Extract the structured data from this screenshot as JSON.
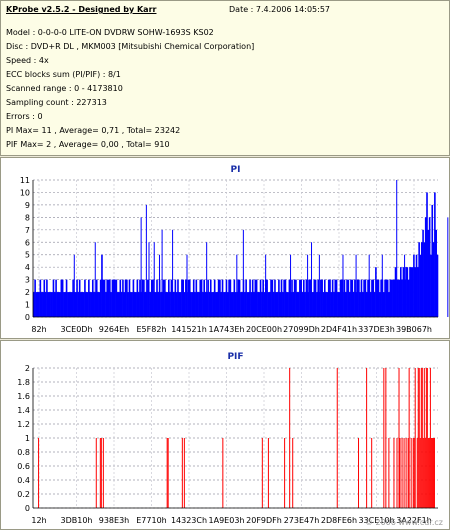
{
  "info": {
    "title": "KProbe v2.5.2 - Designed by Karr",
    "date": "Date : 7.4.2006 14:05:57",
    "lines": [
      "Model : 0-0-0-0 LITE-ON DVDRW SOHW-1693S KS02",
      "Disc : DVD+R DL , MKM003 [Mitsubishi Chemical Corporation]",
      "Speed : 4x",
      "ECC blocks sum (PI/PIF) : 8/1",
      "Scanned range : 0 - 4173810",
      "Sampling count : 227313",
      "Errors : 0",
      "PI Max= 11 , Average= 0,71 , Total= 23242",
      "PIF Max= 2 , Average= 0,00 , Total= 910"
    ]
  },
  "watermark": "© 2006 www.cdr.cz",
  "colors": {
    "pi": "#0000ff",
    "pif": "#ff0000",
    "title": "#1a2fa8"
  },
  "chart_data": [
    {
      "type": "bar",
      "title": "PI",
      "ylim": [
        0,
        11
      ],
      "y_ticks": [
        "0",
        "1",
        "2",
        "3",
        "4",
        "5",
        "6",
        "7",
        "8",
        "9",
        "10",
        "11"
      ],
      "x_ticks": [
        "82h",
        "3CE0Dh",
        "9264Eh",
        "E5F82h",
        "141521h",
        "1A743Eh",
        "20CE00h",
        "27099Dh",
        "2D4F41h",
        "337DE3h",
        "39B067h"
      ],
      "grid": true,
      "series": [
        {
          "values": [
            2,
            3,
            2,
            2,
            2,
            3,
            2,
            2,
            3,
            2,
            3,
            2,
            2,
            2,
            2,
            3,
            2,
            3,
            2,
            2,
            2,
            3,
            3,
            2,
            2,
            3,
            2,
            2,
            2,
            2,
            3,
            2,
            2,
            3,
            2,
            3,
            2,
            2,
            2,
            3,
            2,
            2,
            3,
            2,
            2,
            3,
            2,
            2,
            3,
            2,
            2,
            3,
            5,
            3,
            3,
            2,
            3,
            3,
            3,
            2,
            3,
            3,
            3,
            3,
            2,
            2,
            3,
            2,
            3,
            2,
            3,
            3,
            2,
            3,
            2,
            2,
            3,
            2,
            2,
            3,
            2,
            3,
            2,
            3,
            3,
            2,
            2,
            3,
            2,
            2,
            3,
            3,
            2,
            2,
            3,
            2,
            3,
            2,
            2,
            3,
            3,
            2,
            2,
            3,
            2,
            3,
            2,
            2,
            3,
            2,
            3,
            2,
            2,
            3,
            3,
            2,
            3,
            2,
            3,
            3,
            2,
            2,
            3,
            2,
            3,
            2,
            2,
            3,
            3,
            2,
            3,
            2,
            2,
            3,
            2,
            3,
            2,
            2,
            3,
            2,
            2,
            3,
            3,
            2,
            3,
            2,
            2,
            3,
            2,
            3,
            3,
            2,
            2,
            3,
            2,
            2,
            3,
            3,
            2,
            2,
            3,
            2,
            3,
            2,
            2,
            3,
            2,
            3,
            2,
            3,
            3,
            2,
            2,
            3,
            2,
            3,
            2,
            3,
            3,
            2,
            2,
            3,
            3,
            2,
            3,
            2,
            2,
            3,
            2,
            3,
            2,
            3,
            3,
            2,
            2,
            3,
            2,
            3,
            2,
            3,
            3,
            2,
            2,
            3,
            3,
            2,
            3,
            2,
            3,
            2,
            3,
            3,
            2,
            2,
            3,
            3,
            2,
            3,
            2,
            3,
            3,
            2,
            3,
            2,
            2,
            3,
            3,
            2,
            3,
            2,
            3,
            3,
            2,
            2,
            3,
            3,
            2,
            3,
            2,
            3,
            3,
            2,
            3,
            3,
            2,
            3,
            2,
            3,
            3,
            2,
            3,
            2,
            3,
            3,
            2,
            3,
            3,
            2,
            3,
            3,
            2,
            4,
            3,
            3,
            2,
            3,
            3,
            2,
            3,
            3,
            3,
            2,
            3,
            3,
            3,
            3,
            4,
            3,
            3,
            3,
            4,
            3,
            4,
            3,
            4,
            4,
            3,
            4,
            4,
            4,
            5,
            4,
            5,
            4,
            6,
            5,
            6,
            7,
            6,
            8,
            10,
            7,
            8,
            5,
            9,
            6,
            10,
            7,
            5
          ],
          "peaks": [
            [
              31,
              5
            ],
            [
              47,
              6
            ],
            [
              82,
              8
            ],
            [
              86,
              9
            ],
            [
              88,
              6
            ],
            [
              92,
              6
            ],
            [
              96,
              5
            ],
            [
              98,
              7
            ],
            [
              106,
              7
            ],
            [
              117,
              5
            ],
            [
              132,
              6
            ],
            [
              155,
              5
            ],
            [
              160,
              7
            ],
            [
              177,
              5
            ],
            [
              196,
              5
            ],
            [
              209,
              5
            ],
            [
              212,
              6
            ],
            [
              218,
              5
            ],
            [
              236,
              5
            ],
            [
              246,
              5
            ],
            [
              256,
              5
            ],
            [
              266,
              5
            ],
            [
              277,
              11
            ],
            [
              283,
              5
            ],
            [
              302,
              7
            ],
            [
              316,
              8
            ],
            [
              322,
              6
            ],
            [
              327,
              5
            ],
            [
              333,
              5
            ],
            [
              336,
              7
            ],
            [
              343,
              6
            ],
            [
              355,
              7
            ],
            [
              358,
              5
            ],
            [
              363,
              5
            ],
            [
              367,
              6
            ],
            [
              371,
              5
            ],
            [
              375,
              5
            ],
            [
              378,
              7
            ],
            [
              384,
              6
            ],
            [
              386,
              6
            ],
            [
              390,
              6
            ],
            [
              392,
              6
            ],
            [
              395,
              5
            ]
          ]
        }
      ]
    },
    {
      "type": "bar",
      "title": "PIF",
      "ylim": [
        0,
        2
      ],
      "y_ticks": [
        "0",
        "0.2",
        "0.4",
        "0.6",
        "0.8",
        "1",
        "1.2",
        "1.4",
        "1.6",
        "1.8",
        "2"
      ],
      "x_ticks": [
        "12h",
        "3DB10h",
        "938E3h",
        "E7710h",
        "14323Ch",
        "1A9E03h",
        "20F9DFh",
        "273E47h",
        "2D8FE6h",
        "33CE10h",
        "3A22F1h"
      ],
      "grid": true,
      "series": [
        {
          "spikes": [
            [
              5,
              1
            ],
            [
              62,
              1
            ],
            [
              66,
              1
            ],
            [
              67,
              1
            ],
            [
              69,
              1
            ],
            [
              132,
              1
            ],
            [
              133,
              1
            ],
            [
              147,
              1
            ],
            [
              149,
              1
            ],
            [
              187,
              1
            ],
            [
              226,
              1
            ],
            [
              232,
              1
            ],
            [
              248,
              1
            ],
            [
              253,
              2
            ],
            [
              256,
              1
            ],
            [
              300,
              2
            ],
            [
              321,
              1
            ],
            [
              329,
              2
            ],
            [
              334,
              1
            ],
            [
              346,
              2
            ],
            [
              348,
              2
            ],
            [
              351,
              1
            ],
            [
              356,
              1
            ],
            [
              359,
              1
            ],
            [
              361,
              2
            ],
            [
              362,
              1
            ],
            [
              364,
              1
            ],
            [
              366,
              1
            ],
            [
              368,
              1
            ],
            [
              370,
              1
            ],
            [
              371,
              2
            ],
            [
              373,
              1
            ],
            [
              375,
              1
            ],
            [
              376,
              1
            ],
            [
              377,
              2
            ],
            [
              379,
              1
            ],
            [
              380,
              2
            ],
            [
              381,
              2
            ],
            [
              382,
              1
            ],
            [
              383,
              2
            ],
            [
              384,
              2
            ],
            [
              385,
              1
            ],
            [
              386,
              2
            ],
            [
              387,
              1
            ],
            [
              388,
              2
            ],
            [
              389,
              2
            ],
            [
              390,
              1
            ],
            [
              391,
              1
            ],
            [
              392,
              2
            ],
            [
              393,
              1
            ],
            [
              394,
              1
            ],
            [
              395,
              1
            ],
            [
              396,
              1
            ]
          ]
        }
      ]
    }
  ]
}
